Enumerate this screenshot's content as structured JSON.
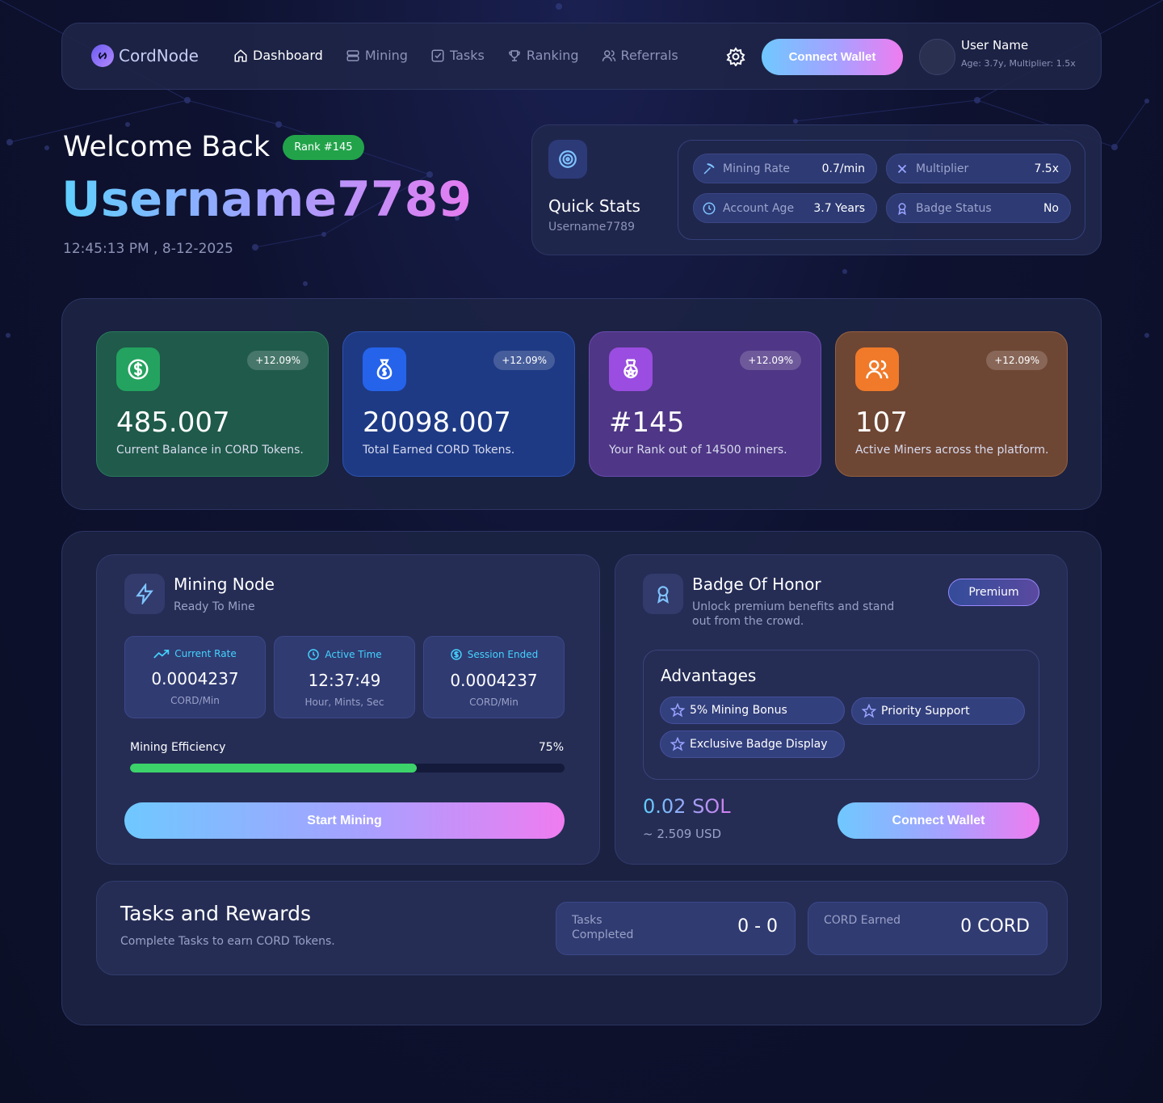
{
  "nav": {
    "brand": "CordNode",
    "items": [
      {
        "label": "Dashboard",
        "icon": "home-icon",
        "active": true
      },
      {
        "label": "Mining",
        "icon": "server-icon",
        "active": false
      },
      {
        "label": "Tasks",
        "icon": "checkbox-icon",
        "active": false
      },
      {
        "label": "Ranking",
        "icon": "trophy-icon",
        "active": false
      },
      {
        "label": "Referrals",
        "icon": "users-icon",
        "active": false
      }
    ],
    "connect_label": "Connect Wallet",
    "user_name": "User Name",
    "user_meta": "Age: 3.7y, Multiplier: 1.5x"
  },
  "hero": {
    "welcome": "Welcome Back",
    "rank_badge": "Rank #145",
    "username": "Username7789",
    "datetime": "12:45:13 PM , 8-12-2025"
  },
  "quick_stats": {
    "title": "Quick Stats",
    "subtitle": "Username7789",
    "items": [
      {
        "label": "Mining Rate",
        "value": "0.7/min",
        "icon": "pickaxe-icon"
      },
      {
        "label": "Multiplier",
        "value": "7.5x",
        "icon": "multiply-icon"
      },
      {
        "label": "Account Age",
        "value": "3.7 Years",
        "icon": "clock-icon"
      },
      {
        "label": "Badge Status",
        "value": "No",
        "icon": "award-icon"
      }
    ]
  },
  "stat_cards": [
    {
      "value": "485.007",
      "desc": "Current Balance in CORD Tokens.",
      "change": "+12.09%",
      "icon": "dollar-icon",
      "color": "#1f5a4a"
    },
    {
      "value": "20098.007",
      "desc": "Total Earned CORD Tokens.",
      "change": "+12.09%",
      "icon": "money-bag-icon",
      "color": "#1e3a85"
    },
    {
      "value": "#145",
      "desc": "Your Rank out of 14500 miners.",
      "change": "+12.09%",
      "icon": "medal-icon",
      "color": "#4f3686"
    },
    {
      "value": "107",
      "desc": "Active Miners across the platform.",
      "change": "+12.09%",
      "icon": "users-icon",
      "color": "#6e4634"
    }
  ],
  "mining": {
    "title": "Mining Node",
    "subtitle": "Ready To Mine",
    "stats": [
      {
        "header": "Current Rate",
        "value": "0.0004237",
        "unit": "CORD/Min",
        "icon": "trend-icon"
      },
      {
        "header": "Active Time",
        "value": "12:37:49",
        "unit": "Hour, Mints, Sec",
        "icon": "clock-icon"
      },
      {
        "header": "Session Ended",
        "value": "0.0004237",
        "unit": "CORD/Min",
        "icon": "coin-icon"
      }
    ],
    "efficiency_label": "Mining Efficiency",
    "efficiency_pct_text": "75%",
    "efficiency": 0.66,
    "start_label": "Start Mining"
  },
  "badge": {
    "title": "Badge Of Honor",
    "subtitle": "Unlock premium benefits and stand out from the crowd.",
    "tier": "Premium",
    "advantages_title": "Advantages",
    "advantages": [
      "5% Mining Bonus",
      "Priority Support",
      "Exclusive Badge Display"
    ],
    "price": "0.02 SOL",
    "price_usd": "~ 2.509 USD",
    "connect_label": "Connect Wallet"
  },
  "tasks": {
    "title": "Tasks and Rewards",
    "subtitle": "Complete Tasks to earn CORD Tokens.",
    "completed_label": "Tasks Completed",
    "completed_value": "0 - 0",
    "earned_label": "CORD Earned",
    "earned_value": "0 CORD"
  }
}
